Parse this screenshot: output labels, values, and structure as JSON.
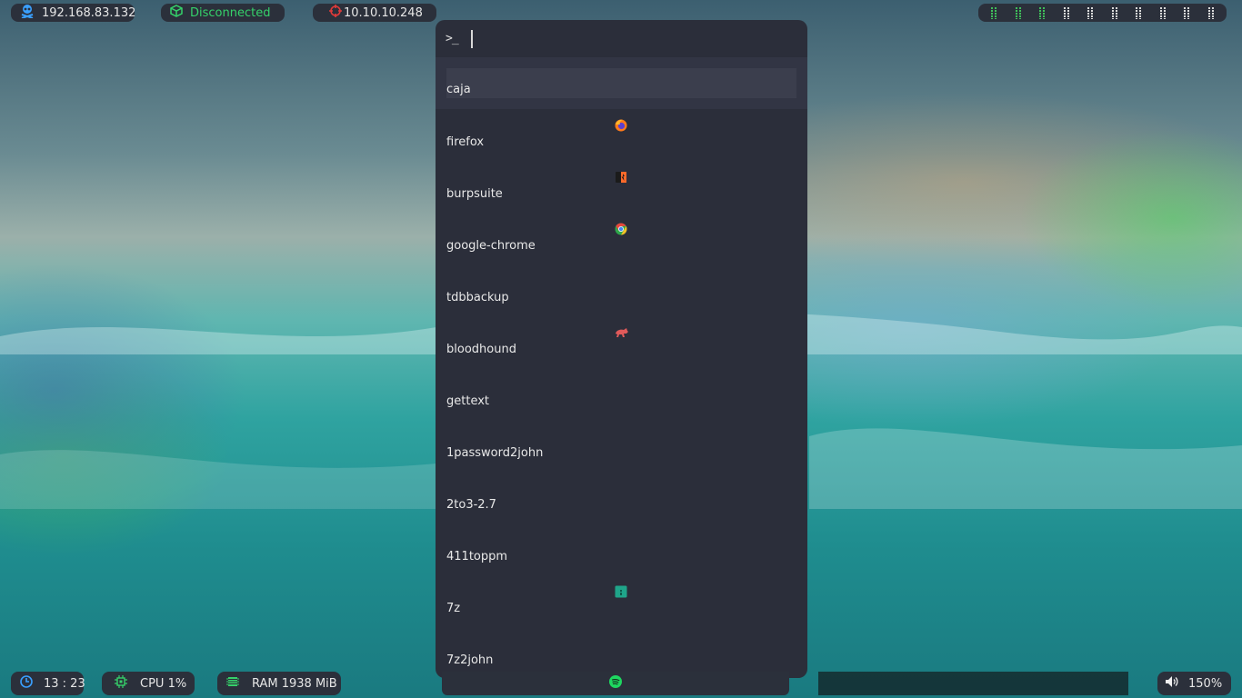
{
  "top_bar": {
    "ip_address": "192.168.83.132",
    "vpn_status": "Disconnected",
    "target_ip": "10.10.10.248",
    "workspaces": [
      {
        "state": "occupied"
      },
      {
        "state": "occupied"
      },
      {
        "state": "occupied"
      },
      {
        "state": "empty"
      },
      {
        "state": "empty"
      },
      {
        "state": "empty"
      },
      {
        "state": "empty"
      },
      {
        "state": "empty"
      },
      {
        "state": "empty"
      },
      {
        "state": "empty"
      }
    ]
  },
  "launcher": {
    "prompt_symbol": ">_",
    "search_value": "",
    "items": [
      {
        "name": "caja",
        "icon": "none",
        "selected": true
      },
      {
        "name": "firefox",
        "icon": "firefox-icon"
      },
      {
        "name": "burpsuite",
        "icon": "burpsuite-icon"
      },
      {
        "name": "google-chrome",
        "icon": "chrome-icon"
      },
      {
        "name": "tdbbackup",
        "icon": "none"
      },
      {
        "name": "bloodhound",
        "icon": "bloodhound-icon"
      },
      {
        "name": "gettext",
        "icon": "none"
      },
      {
        "name": "1password2john",
        "icon": "none"
      },
      {
        "name": "2to3-2.7",
        "icon": "none"
      },
      {
        "name": "411toppm",
        "icon": "none"
      },
      {
        "name": "7z",
        "icon": "archive-icon"
      },
      {
        "name": "7z2john",
        "icon": "none"
      }
    ]
  },
  "bottom_bar": {
    "clock": "13 : 23",
    "cpu": "CPU 1%",
    "ram": "RAM 1938 MiB",
    "volume": "150%",
    "media_icon": "spotify-icon"
  },
  "colors": {
    "bar_bg": "#2b303b",
    "launcher_bg": "#2b2e3a",
    "accent_green": "#35d16a",
    "accent_blue": "#3aa0ff",
    "target_red": "#e03a3a"
  }
}
